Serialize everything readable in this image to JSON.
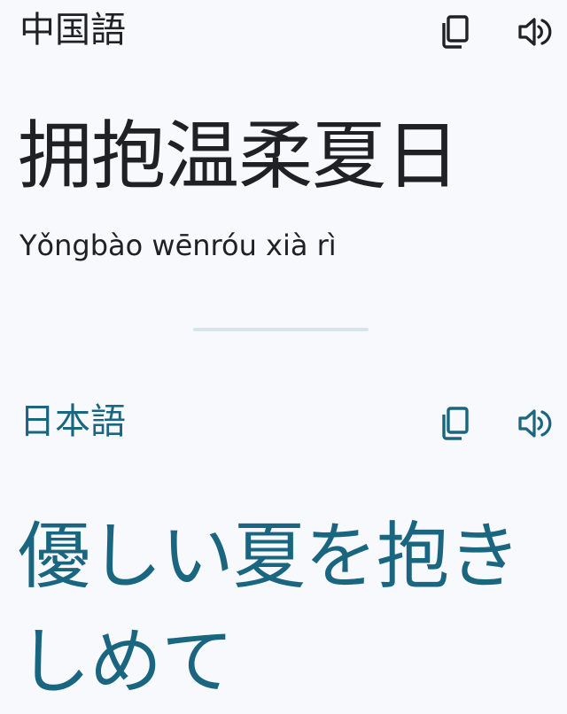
{
  "source": {
    "language": "中国語",
    "text": "拥抱温柔夏日",
    "romanization": "Yǒngbào wēnróu xià rì",
    "icons": {
      "copy": "copy-icon",
      "speak": "speaker-icon"
    }
  },
  "target": {
    "language": "日本語",
    "text": "優しい夏を抱きしめて",
    "icons": {
      "copy": "copy-icon",
      "speak": "speaker-icon"
    }
  },
  "colors": {
    "background": "#f8f9fc",
    "source_text": "#202124",
    "target_text": "#1a6680",
    "divider": "#d6e4ee"
  }
}
